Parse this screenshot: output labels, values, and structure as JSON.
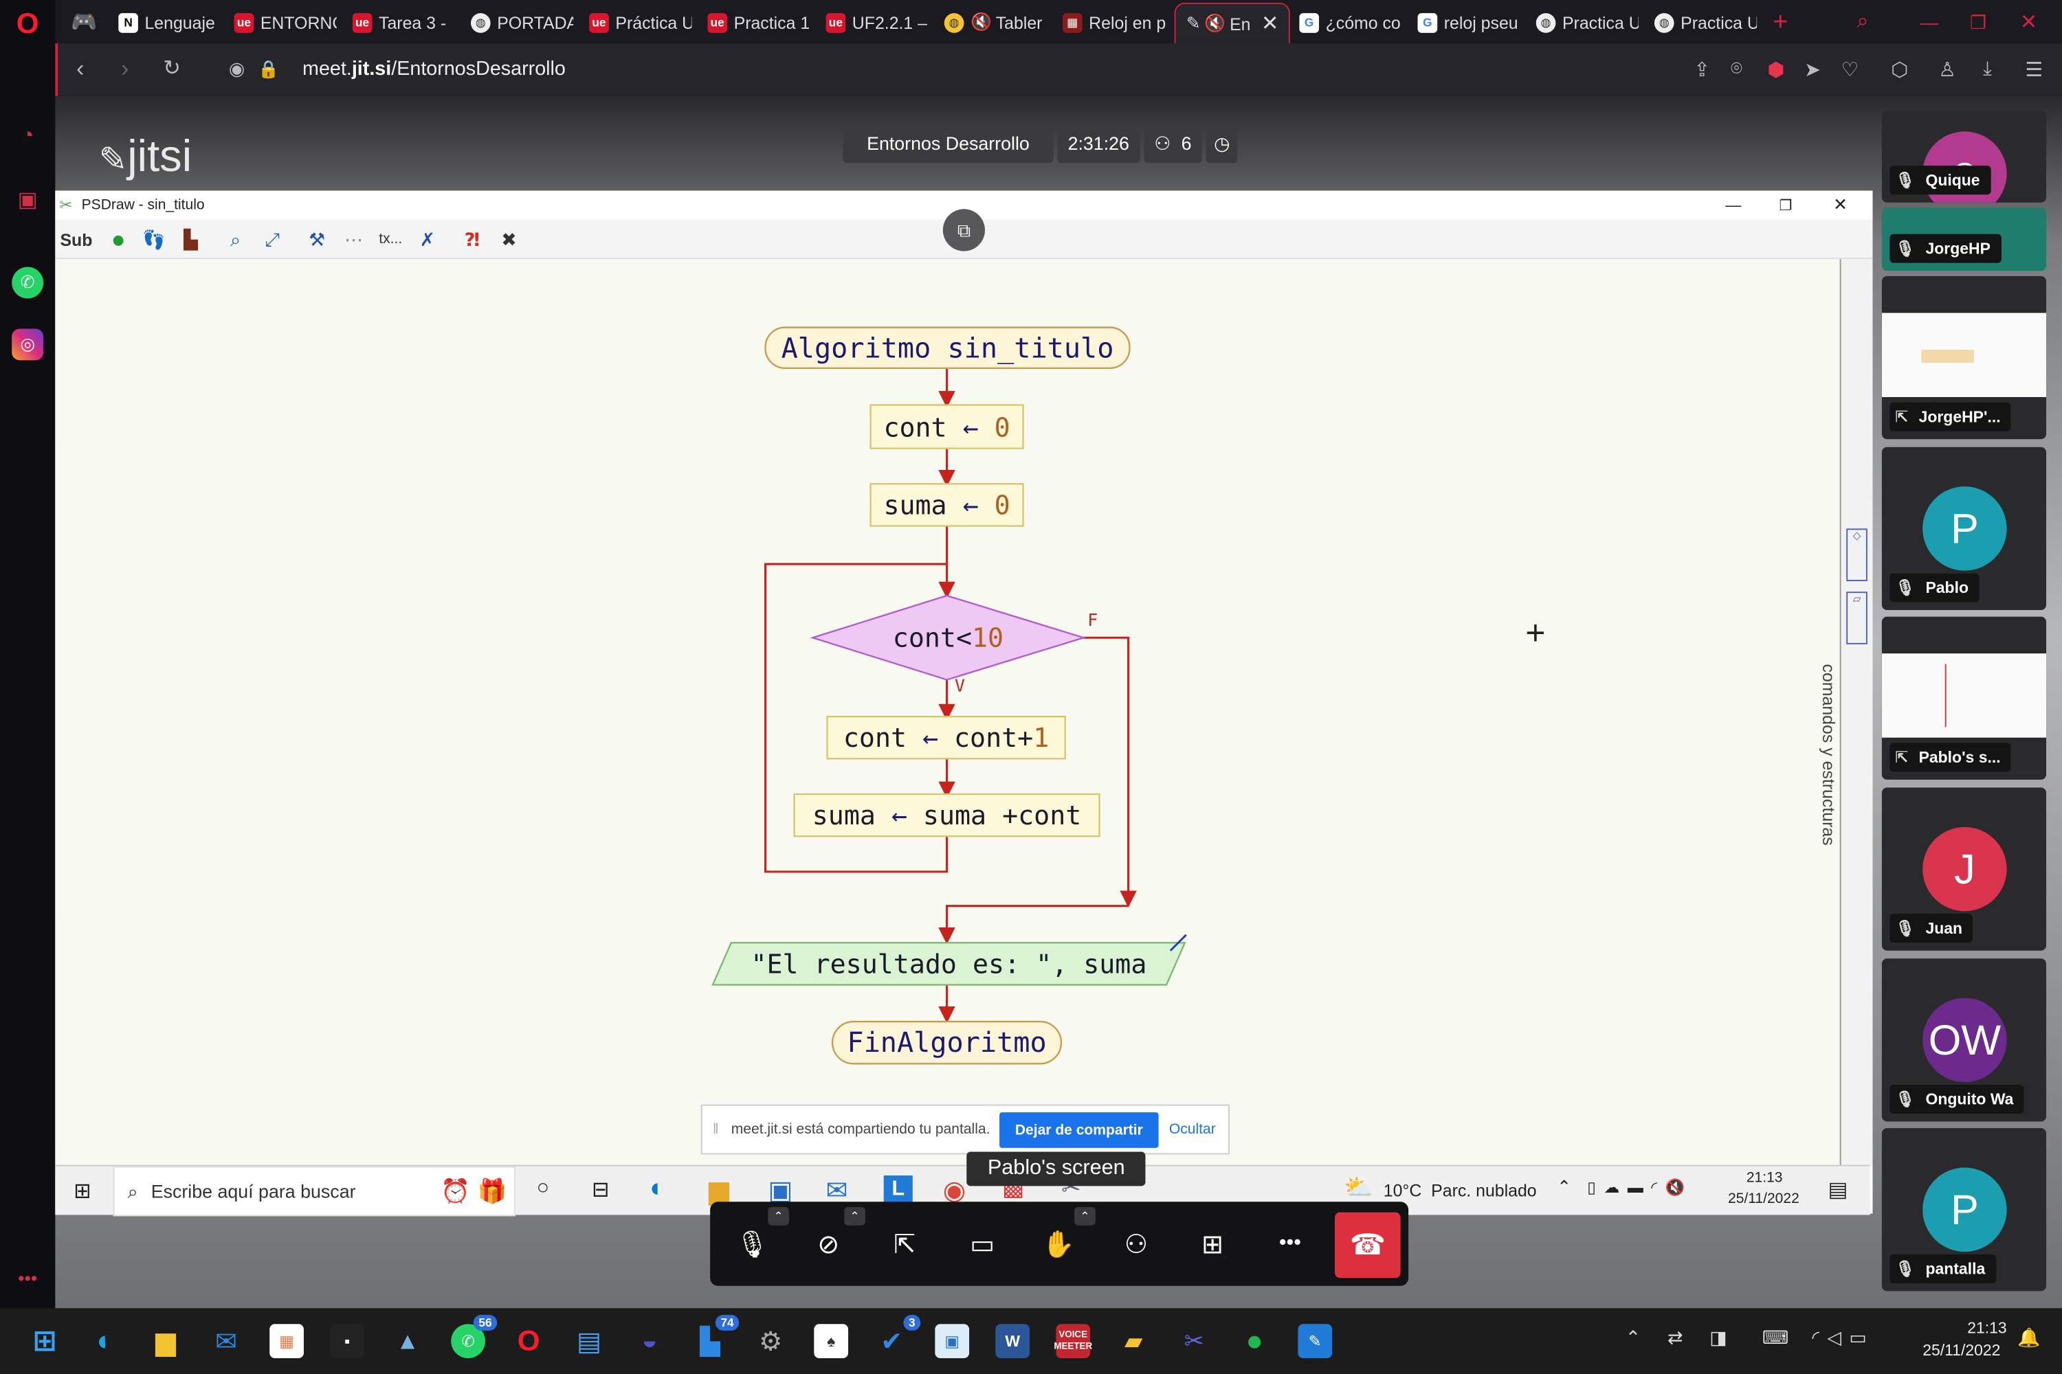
{
  "browser": {
    "tabs": [
      {
        "label": "Lenguaje",
        "favicon": "N"
      },
      {
        "label": "ENTORNC",
        "favicon": "ue"
      },
      {
        "label": "Tarea 3 -",
        "favicon": "ue"
      },
      {
        "label": "PORTADA",
        "favicon": "globe"
      },
      {
        "label": "Práctica U",
        "favicon": "ue"
      },
      {
        "label": "Practica 1",
        "favicon": "ue"
      },
      {
        "label": "UF2.2.1 –",
        "favicon": "ue"
      },
      {
        "label": "Tabler",
        "favicon": "globe-muted"
      },
      {
        "label": "Reloj en p",
        "favicon": "red"
      },
      {
        "label": "En",
        "favicon": "jitsi-muted"
      },
      {
        "label": "¿cómo co",
        "favicon": "G"
      },
      {
        "label": "reloj pseu",
        "favicon": "G"
      },
      {
        "label": "Practica U",
        "favicon": "globe"
      },
      {
        "label": "Practica U",
        "favicon": "globe"
      }
    ],
    "url_prefix": "meet.",
    "url_domain": "jit.si",
    "url_path": "/EntornosDesarrollo"
  },
  "jitsi": {
    "logo": "jitsi",
    "meeting_title": "Entornos Desarrollo",
    "timer": "2:31:26",
    "participant_count": "6"
  },
  "psdraw": {
    "window_title": "PSDraw - sin_titulo",
    "side_panel_label": "comandos y estructuras",
    "toolbar_sub": "Sub",
    "toolbar_text": "tx..."
  },
  "flowchart": {
    "start": "Algoritmo sin_titulo",
    "assign1_var": "cont",
    "assign1_val": "0",
    "assign2_var": "suma",
    "assign2_val": "0",
    "cond_var": "cont<",
    "cond_val": "10",
    "true_label": "V",
    "false_label": "F",
    "body1_lhs": "cont",
    "body1_rhs": "cont+",
    "body1_num": "1",
    "body2_lhs": "suma",
    "body2_rhs": "suma +cont",
    "output": "\"El resultado es: \", suma",
    "end": "FinAlgoritmo",
    "arrow": "←"
  },
  "share_notice": {
    "text": "meet.jit.si está compartiendo tu pantalla.",
    "stop_button": "Dejar de compartir",
    "hide_button": "Ocultar"
  },
  "screen_label": "Pablo's screen",
  "win10_taskbar": {
    "search_placeholder": "Escribe aquí para buscar",
    "weather": "10°C  Parc. nublado",
    "time": "21:13",
    "date": "25/11/2022"
  },
  "participants": [
    {
      "name": "Quique",
      "initial": "Q",
      "color": "#b23b8f",
      "type": "avatar"
    },
    {
      "name": "JorgeHP",
      "initial": "",
      "color": "#1e9a8a",
      "type": "avatar"
    },
    {
      "name": "JorgeHP'...",
      "initial": "",
      "color": "",
      "type": "screen"
    },
    {
      "name": "Pablo",
      "initial": "P",
      "color": "#1a9eb0",
      "type": "avatar"
    },
    {
      "name": "Pablo's s...",
      "initial": "",
      "color": "",
      "type": "screen"
    },
    {
      "name": "Juan",
      "initial": "J",
      "color": "#d9334d",
      "type": "avatar"
    },
    {
      "name": "Onguito Wa",
      "initial": "OW",
      "color": "#6b2a8c",
      "type": "avatar"
    },
    {
      "name": "pantalla",
      "initial": "P",
      "color": "#1a9eb0",
      "type": "avatar"
    }
  ],
  "win11_taskbar": {
    "badges": {
      "whatsapp": "56",
      "teams": "74",
      "todo": "3"
    },
    "voice_label": "VOICE",
    "meeter_label": "MEETER",
    "time": "21:13",
    "date": "25/11/2022"
  },
  "colors": {
    "accent_red": "#d4213d",
    "flow_line": "#c8221c",
    "process_fill": "#fdf8d7",
    "decision_fill": "#eec9f3",
    "io_fill": "#d9f3d3",
    "stop_share_blue": "#1a73e8",
    "hangup_red": "#dd303f"
  }
}
